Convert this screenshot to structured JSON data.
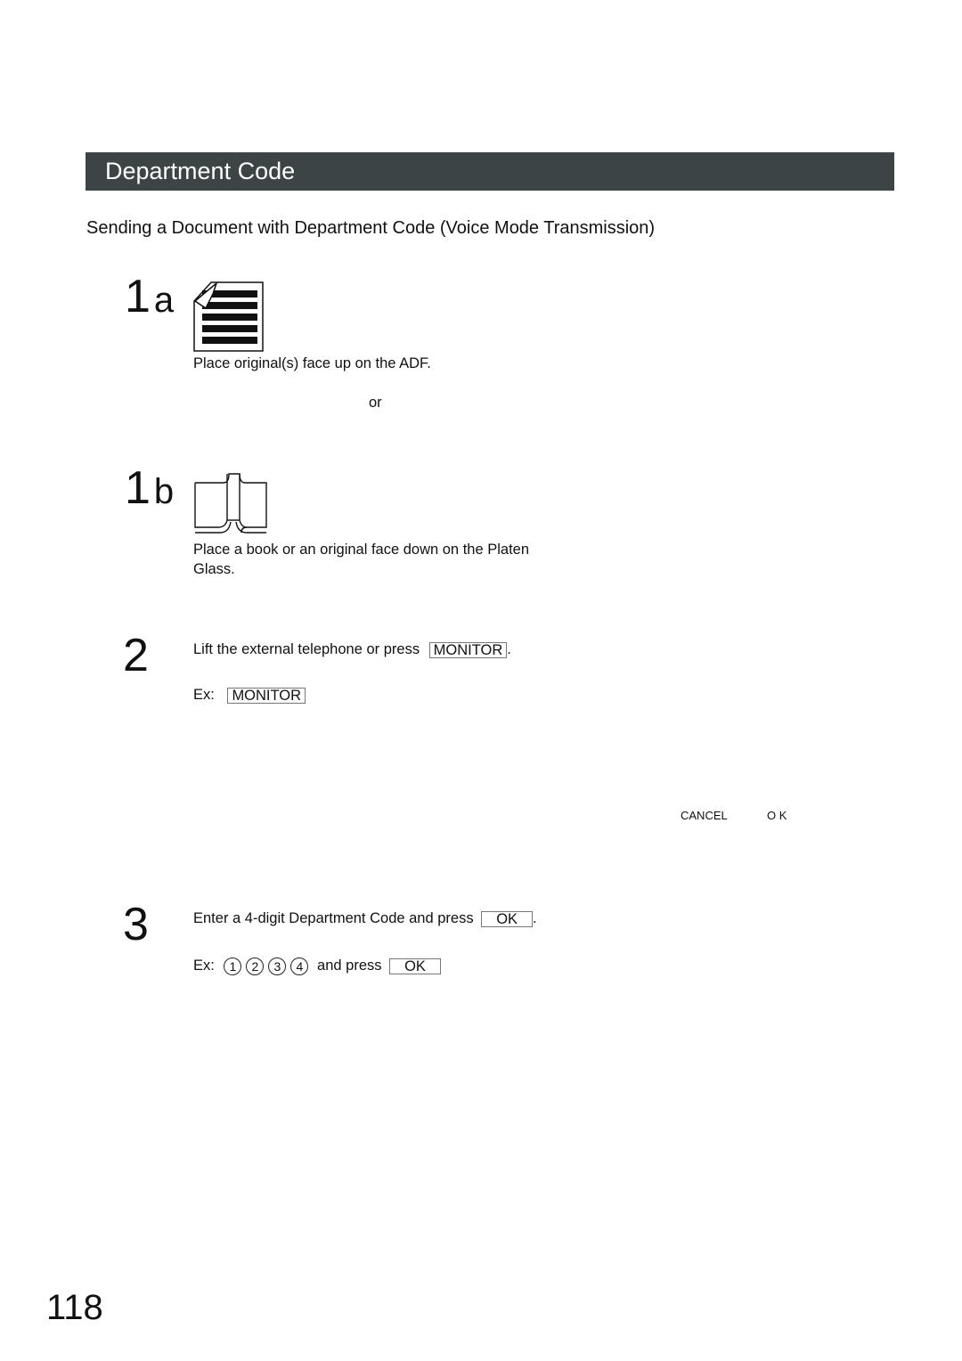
{
  "section": {
    "title": "Department Code"
  },
  "subtitle": "Sending a Document with Department Code (Voice Mode Transmission)",
  "steps": {
    "s1a": {
      "number": "1",
      "suffix": "a",
      "icon": "adf-document-icon",
      "text": "Place original(s) face up on the ADF."
    },
    "or_label": "or",
    "s1b": {
      "number": "1",
      "suffix": "b",
      "icon": "open-book-icon",
      "text_line1": "Place a book or an original face down on the Platen",
      "text_line2": "Glass."
    },
    "s2": {
      "number": "2",
      "text": "Lift the external telephone or press",
      "key": "MONITOR",
      "text_end": ".",
      "example_prefix": "Ex:",
      "example_key": "MONITOR"
    },
    "display_labels": {
      "cancel": "CANCEL",
      "ok": "O K"
    },
    "s3": {
      "number": "3",
      "text": "Enter a 4-digit Department Code and press",
      "key": "OK",
      "text_end": ".",
      "example_prefix": "Ex:",
      "example_digits": [
        "1",
        "2",
        "3",
        "4"
      ],
      "example_mid": "and press",
      "example_key": "OK"
    }
  },
  "page_number": "118"
}
